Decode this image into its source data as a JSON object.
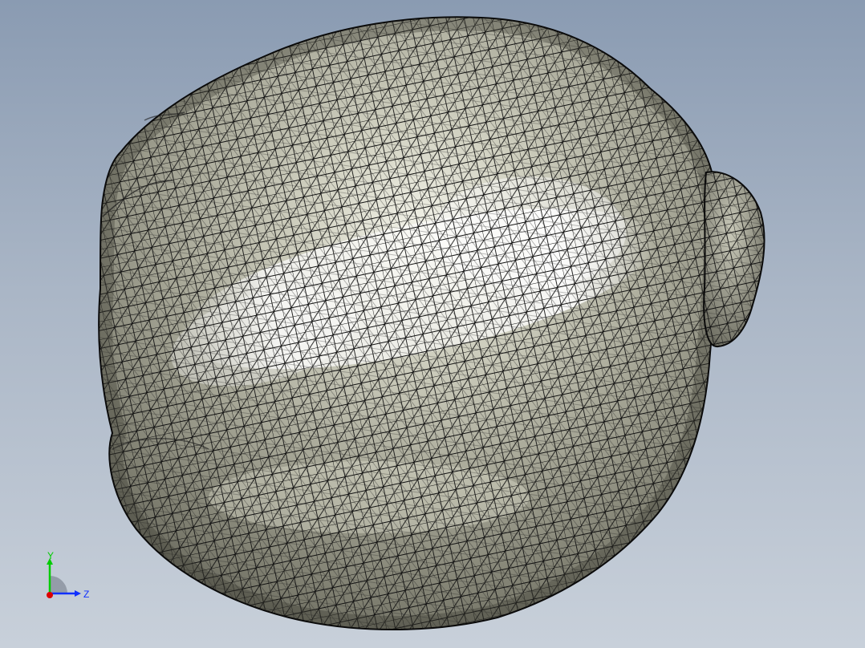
{
  "viewport": {
    "background_top": "#8a9bb2",
    "background_bottom": "#c8d0da",
    "model": {
      "shape": "tessellated-ellipsoid-mesh",
      "fill_color": "#9c9c8c",
      "highlight_color": "#ffffff",
      "mesh_color": "#111111",
      "display_mode": "shaded-with-edges"
    }
  },
  "triad": {
    "y_label": "Y",
    "z_label": "Z",
    "y_color": "#00cc00",
    "z_color": "#1030ff",
    "x_color": "#dd0000"
  }
}
